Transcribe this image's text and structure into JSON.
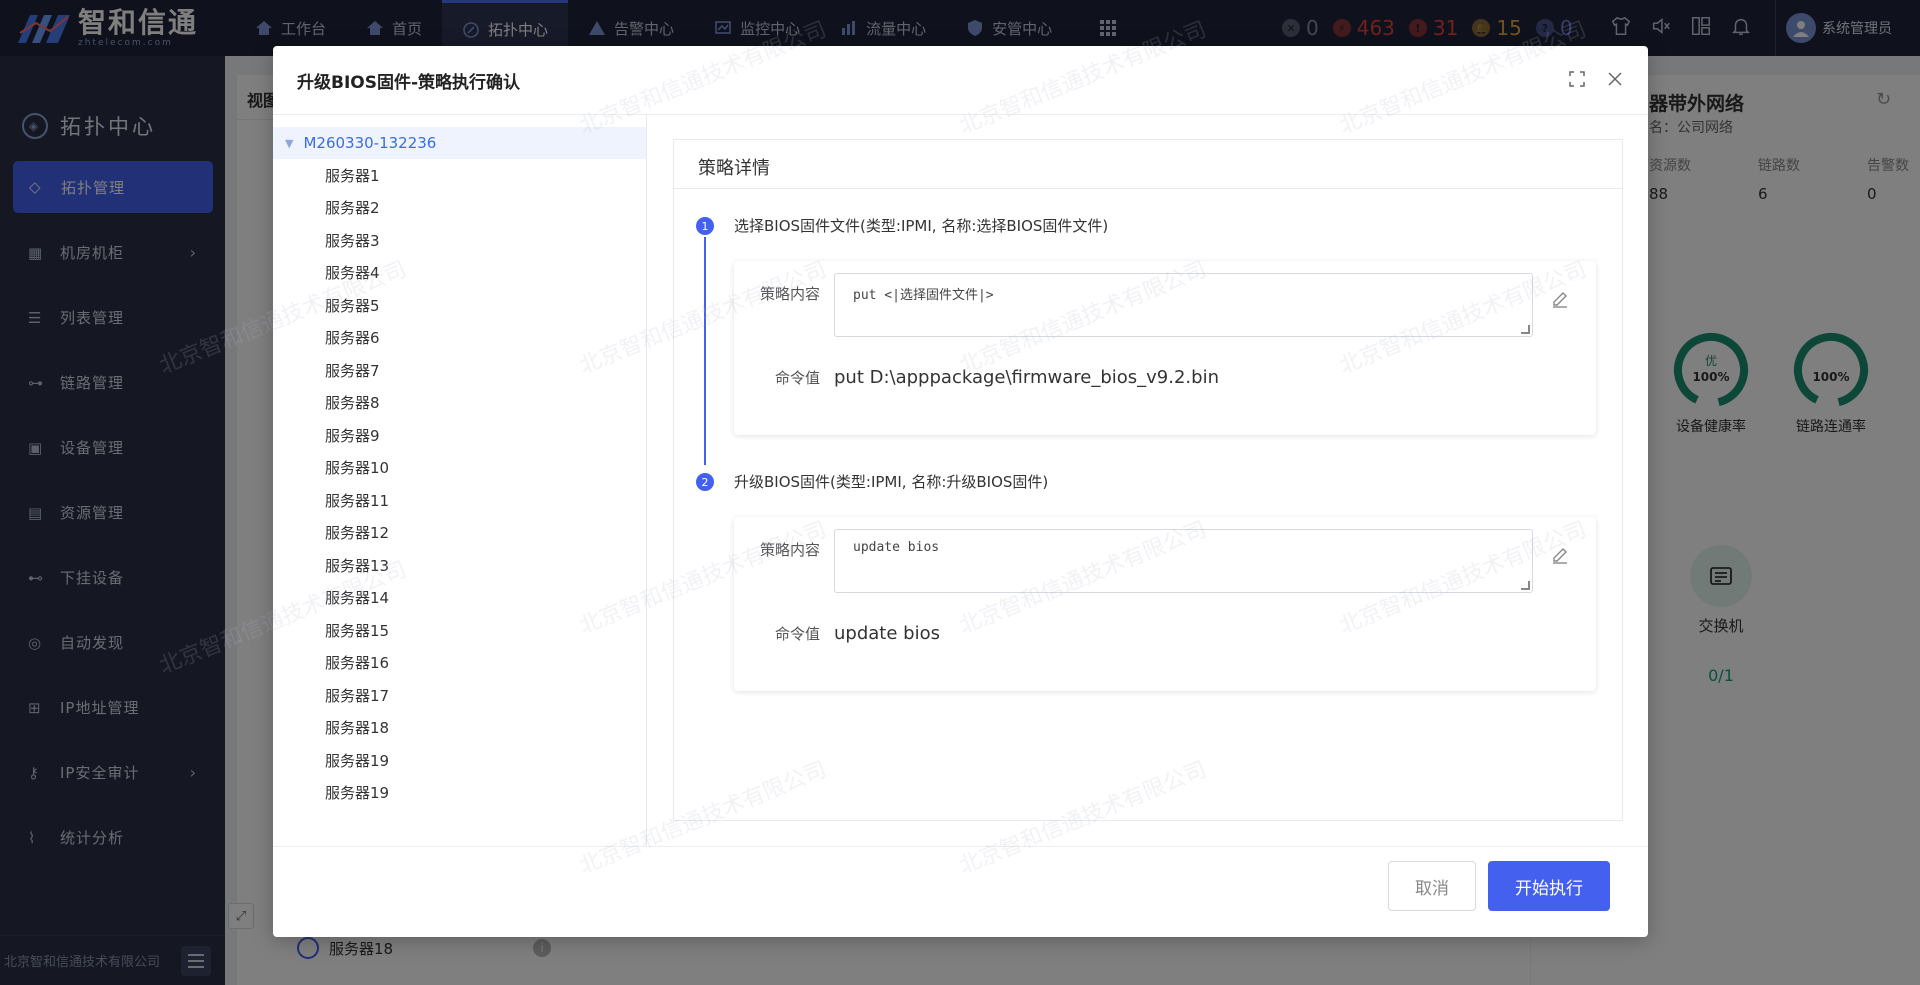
{
  "brand": {
    "name": "智和信通",
    "sub": "zhtelecom.com"
  },
  "topnav": [
    {
      "label": "工作台",
      "icon": "home-icon"
    },
    {
      "label": "首页",
      "icon": "home-icon"
    },
    {
      "label": "拓扑中心",
      "icon": "topology-icon",
      "active": true
    },
    {
      "label": "告警中心",
      "icon": "alert-icon"
    },
    {
      "label": "监控中心",
      "icon": "monitor-icon"
    },
    {
      "label": "流量中心",
      "icon": "traffic-icon"
    },
    {
      "label": "安管中心",
      "icon": "shield-icon"
    }
  ],
  "alarm_counts": [
    {
      "value": "0",
      "color": "#8a8f9e"
    },
    {
      "value": "463",
      "color": "#e3423b"
    },
    {
      "value": "31",
      "color": "#e3423b"
    },
    {
      "value": "15",
      "color": "#e6a23c"
    },
    {
      "value": "0",
      "color": "#6d79d8"
    }
  ],
  "user": {
    "name": "系统管理员"
  },
  "sidebar": {
    "title": "拓扑中心",
    "items": [
      {
        "label": "拓扑管理",
        "active": true
      },
      {
        "label": "机房机柜",
        "arrow": true
      },
      {
        "label": "列表管理"
      },
      {
        "label": "链路管理"
      },
      {
        "label": "设备管理"
      },
      {
        "label": "资源管理"
      },
      {
        "label": "下挂设备"
      },
      {
        "label": "自动发现"
      },
      {
        "label": "IP地址管理"
      },
      {
        "label": "IP安全审计",
        "arrow": true
      },
      {
        "label": "统计分析"
      }
    ],
    "footer": "北京智和信通技术有限公司"
  },
  "background": {
    "view_title": "视图",
    "bottom_row": "服务器18",
    "right": {
      "title": "器带外网络",
      "subtitle": "名：公司网络",
      "stats": [
        {
          "k": "资源数",
          "v": "88"
        },
        {
          "k": "链路数",
          "v": "6"
        },
        {
          "k": "告警数",
          "v": "0"
        }
      ],
      "gauges": [
        {
          "top": "优",
          "value": "100%",
          "label": "设备健康率"
        },
        {
          "top": "",
          "value": "100%",
          "label": "链路连通率"
        }
      ],
      "switch": {
        "label": "交换机",
        "ratio": "0/1"
      }
    }
  },
  "modal": {
    "title": "升级BIOS固件-策略执行确认",
    "tree": {
      "root": "M260330-132236",
      "nodes": [
        "服务器1",
        "服务器2",
        "服务器3",
        "服务器4",
        "服务器5",
        "服务器6",
        "服务器7",
        "服务器8",
        "服务器9",
        "服务器10",
        "服务器11",
        "服务器12",
        "服务器13",
        "服务器14",
        "服务器15",
        "服务器16",
        "服务器17",
        "服务器18",
        "服务器19",
        "服务器19"
      ]
    },
    "detail_title": "策略详情",
    "steps": [
      {
        "num": "1",
        "title": "选择BIOS固件文件(类型:IPMI, 名称:选择BIOS固件文件)",
        "content_label": "策略内容",
        "content": "put <|选择固件文件|>",
        "cmd_label": "命令值",
        "cmd": "put D:\\apppackage\\firmware_bios_v9.2.bin"
      },
      {
        "num": "2",
        "title": "升级BIOS固件(类型:IPMI, 名称:升级BIOS固件)",
        "content_label": "策略内容",
        "content": "update bios",
        "cmd_label": "命令值",
        "cmd": "update bios"
      }
    ],
    "cancel_label": "取消",
    "run_label": "开始执行"
  },
  "watermark": "北京智和信通技术有限公司"
}
